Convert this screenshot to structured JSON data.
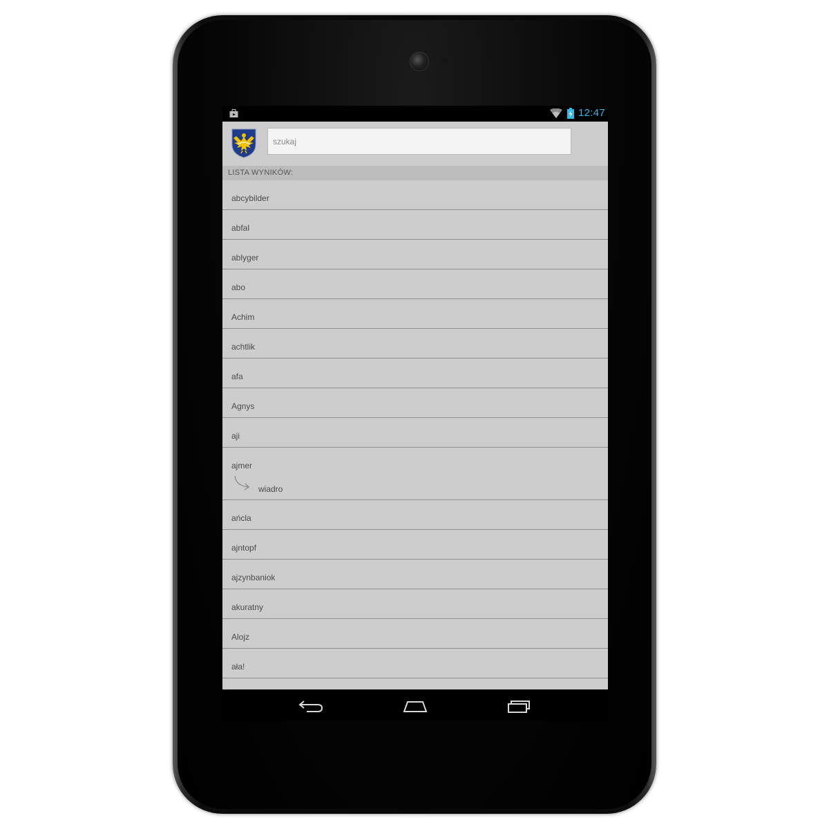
{
  "status_bar": {
    "time": "12:47",
    "icons": [
      "shopping-bag-icon",
      "wifi-icon",
      "battery-charging-icon"
    ],
    "time_color": "#33b5e5"
  },
  "header": {
    "logo": "silesian-eagle-crest-icon",
    "search_placeholder": "szukaj",
    "search_value": ""
  },
  "list_header": "LISTA WYNIKÓW:",
  "results": [
    {
      "word": "abcybilder"
    },
    {
      "word": "abfal"
    },
    {
      "word": "ablyger"
    },
    {
      "word": "abo"
    },
    {
      "word": "Achim"
    },
    {
      "word": "achtlik"
    },
    {
      "word": "afa"
    },
    {
      "word": "Agnys"
    },
    {
      "word": "aji"
    },
    {
      "word": "ajmer",
      "translation": "wiadro"
    },
    {
      "word": "ańcla"
    },
    {
      "word": "ajntopf"
    },
    {
      "word": "ajzynbaniok"
    },
    {
      "word": "akuratny"
    },
    {
      "word": "Alojz"
    },
    {
      "word": "ała!"
    }
  ],
  "nav_bar": {
    "buttons": [
      "back-icon",
      "home-icon",
      "recent-apps-icon"
    ]
  },
  "colors": {
    "app_background": "#cdcdcd",
    "section_header": "#bcbcbc",
    "divider": "#8e8e8e",
    "crest_blue": "#1f3b8c",
    "crest_gold": "#f2c200"
  }
}
